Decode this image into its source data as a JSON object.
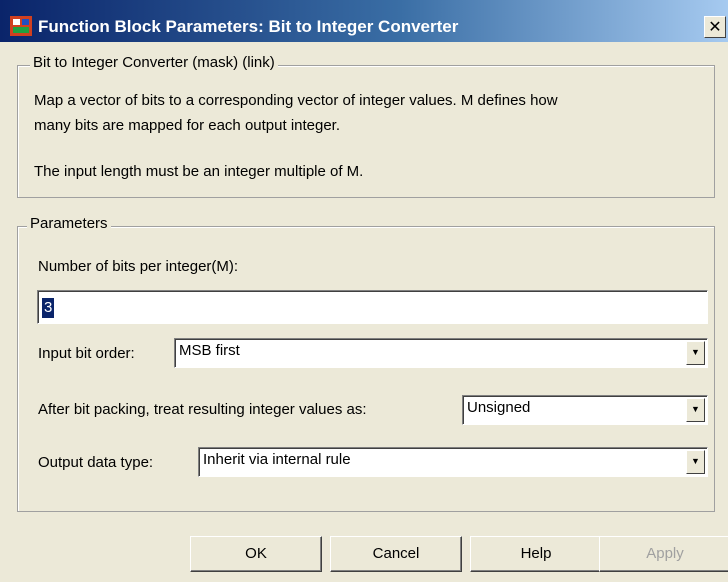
{
  "window": {
    "title": "Function Block Parameters: Bit to Integer Converter",
    "close_glyph": "✕",
    "app_icon": "simulink-block-icon"
  },
  "description": {
    "legend": "Bit to Integer Converter (mask) (link)",
    "line1": "Map a vector of bits to a corresponding vector of integer values. M defines how",
    "line2": "many bits are mapped for each output integer.",
    "line3": "The input length must be an integer multiple of M."
  },
  "parameters": {
    "legend": "Parameters",
    "bits_label": "Number of bits per integer(M):",
    "bits_value": "3",
    "order_label": "Input bit order:",
    "order_value": "MSB first",
    "packing_label": "After bit packing, treat resulting integer values as:",
    "packing_value": "Unsigned",
    "dtype_label": "Output data type:",
    "dtype_value": "Inherit via internal rule",
    "dropdown_glyph": "▼"
  },
  "buttons": {
    "ok": "OK",
    "cancel": "Cancel",
    "help": "Help",
    "apply": "Apply"
  },
  "colors": {
    "title_bar": "#0a246a",
    "dialog_bg": "#ece9d8",
    "selection": "#0a246a"
  }
}
